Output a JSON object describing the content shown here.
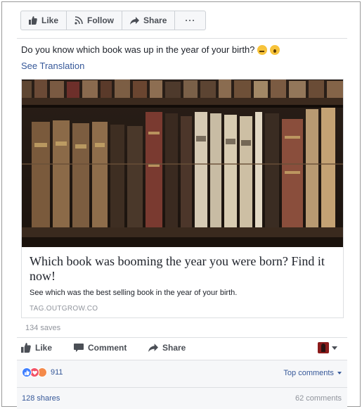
{
  "toolbar": {
    "like_label": "Like",
    "follow_label": "Follow",
    "share_label": "Share",
    "more_label": "···"
  },
  "post": {
    "message": "Do you know which book was up in the year of your birth?",
    "see_translation": "See Translation",
    "emojis": [
      "thinking-face",
      "surprised-face"
    ]
  },
  "link_card": {
    "title": "Which book was booming the year you were born? Find it now!",
    "description": "See which was the best selling book in the year of your birth.",
    "domain": "TAG.OUTGROW.CO"
  },
  "saves": "134 saves",
  "actions": {
    "like_label": "Like",
    "comment_label": "Comment",
    "share_label": "Share"
  },
  "footer": {
    "reaction_count": "911",
    "top_comments": "Top comments",
    "shares": "128 shares",
    "comments": "62 comments"
  },
  "colors": {
    "link_blue": "#365899",
    "like_blue": "#4080ff",
    "love_red": "#f25268",
    "angry_orange": "#f48a4a"
  }
}
